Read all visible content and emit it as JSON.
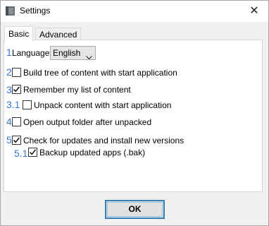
{
  "window": {
    "title": "Settings",
    "close_glyph": "✕",
    "icon": "app-icon"
  },
  "tabs": [
    {
      "label": "Basic",
      "active": true
    },
    {
      "label": "Advanced",
      "active": false
    }
  ],
  "language": {
    "index": "1",
    "label": "Language:",
    "selected": "English"
  },
  "options": [
    {
      "index": "2",
      "label": "Build tree of content with start application",
      "checked": false
    },
    {
      "index": "3",
      "label": "Remember my list of content",
      "checked": true
    },
    {
      "index": "3.1",
      "label": "Unpack content with start application",
      "checked": false
    },
    {
      "index": "4",
      "label": "Open output folder after unpacked",
      "checked": false
    },
    {
      "index": "5",
      "label": "Check for updates and install new versions",
      "checked": true
    },
    {
      "index": "5.1",
      "label": "Backup updated apps (.bak)",
      "checked": true
    }
  ],
  "ok_label": "OK",
  "colors": {
    "annotation": "#3a78d4",
    "ok_border": "#3c7fb1"
  }
}
